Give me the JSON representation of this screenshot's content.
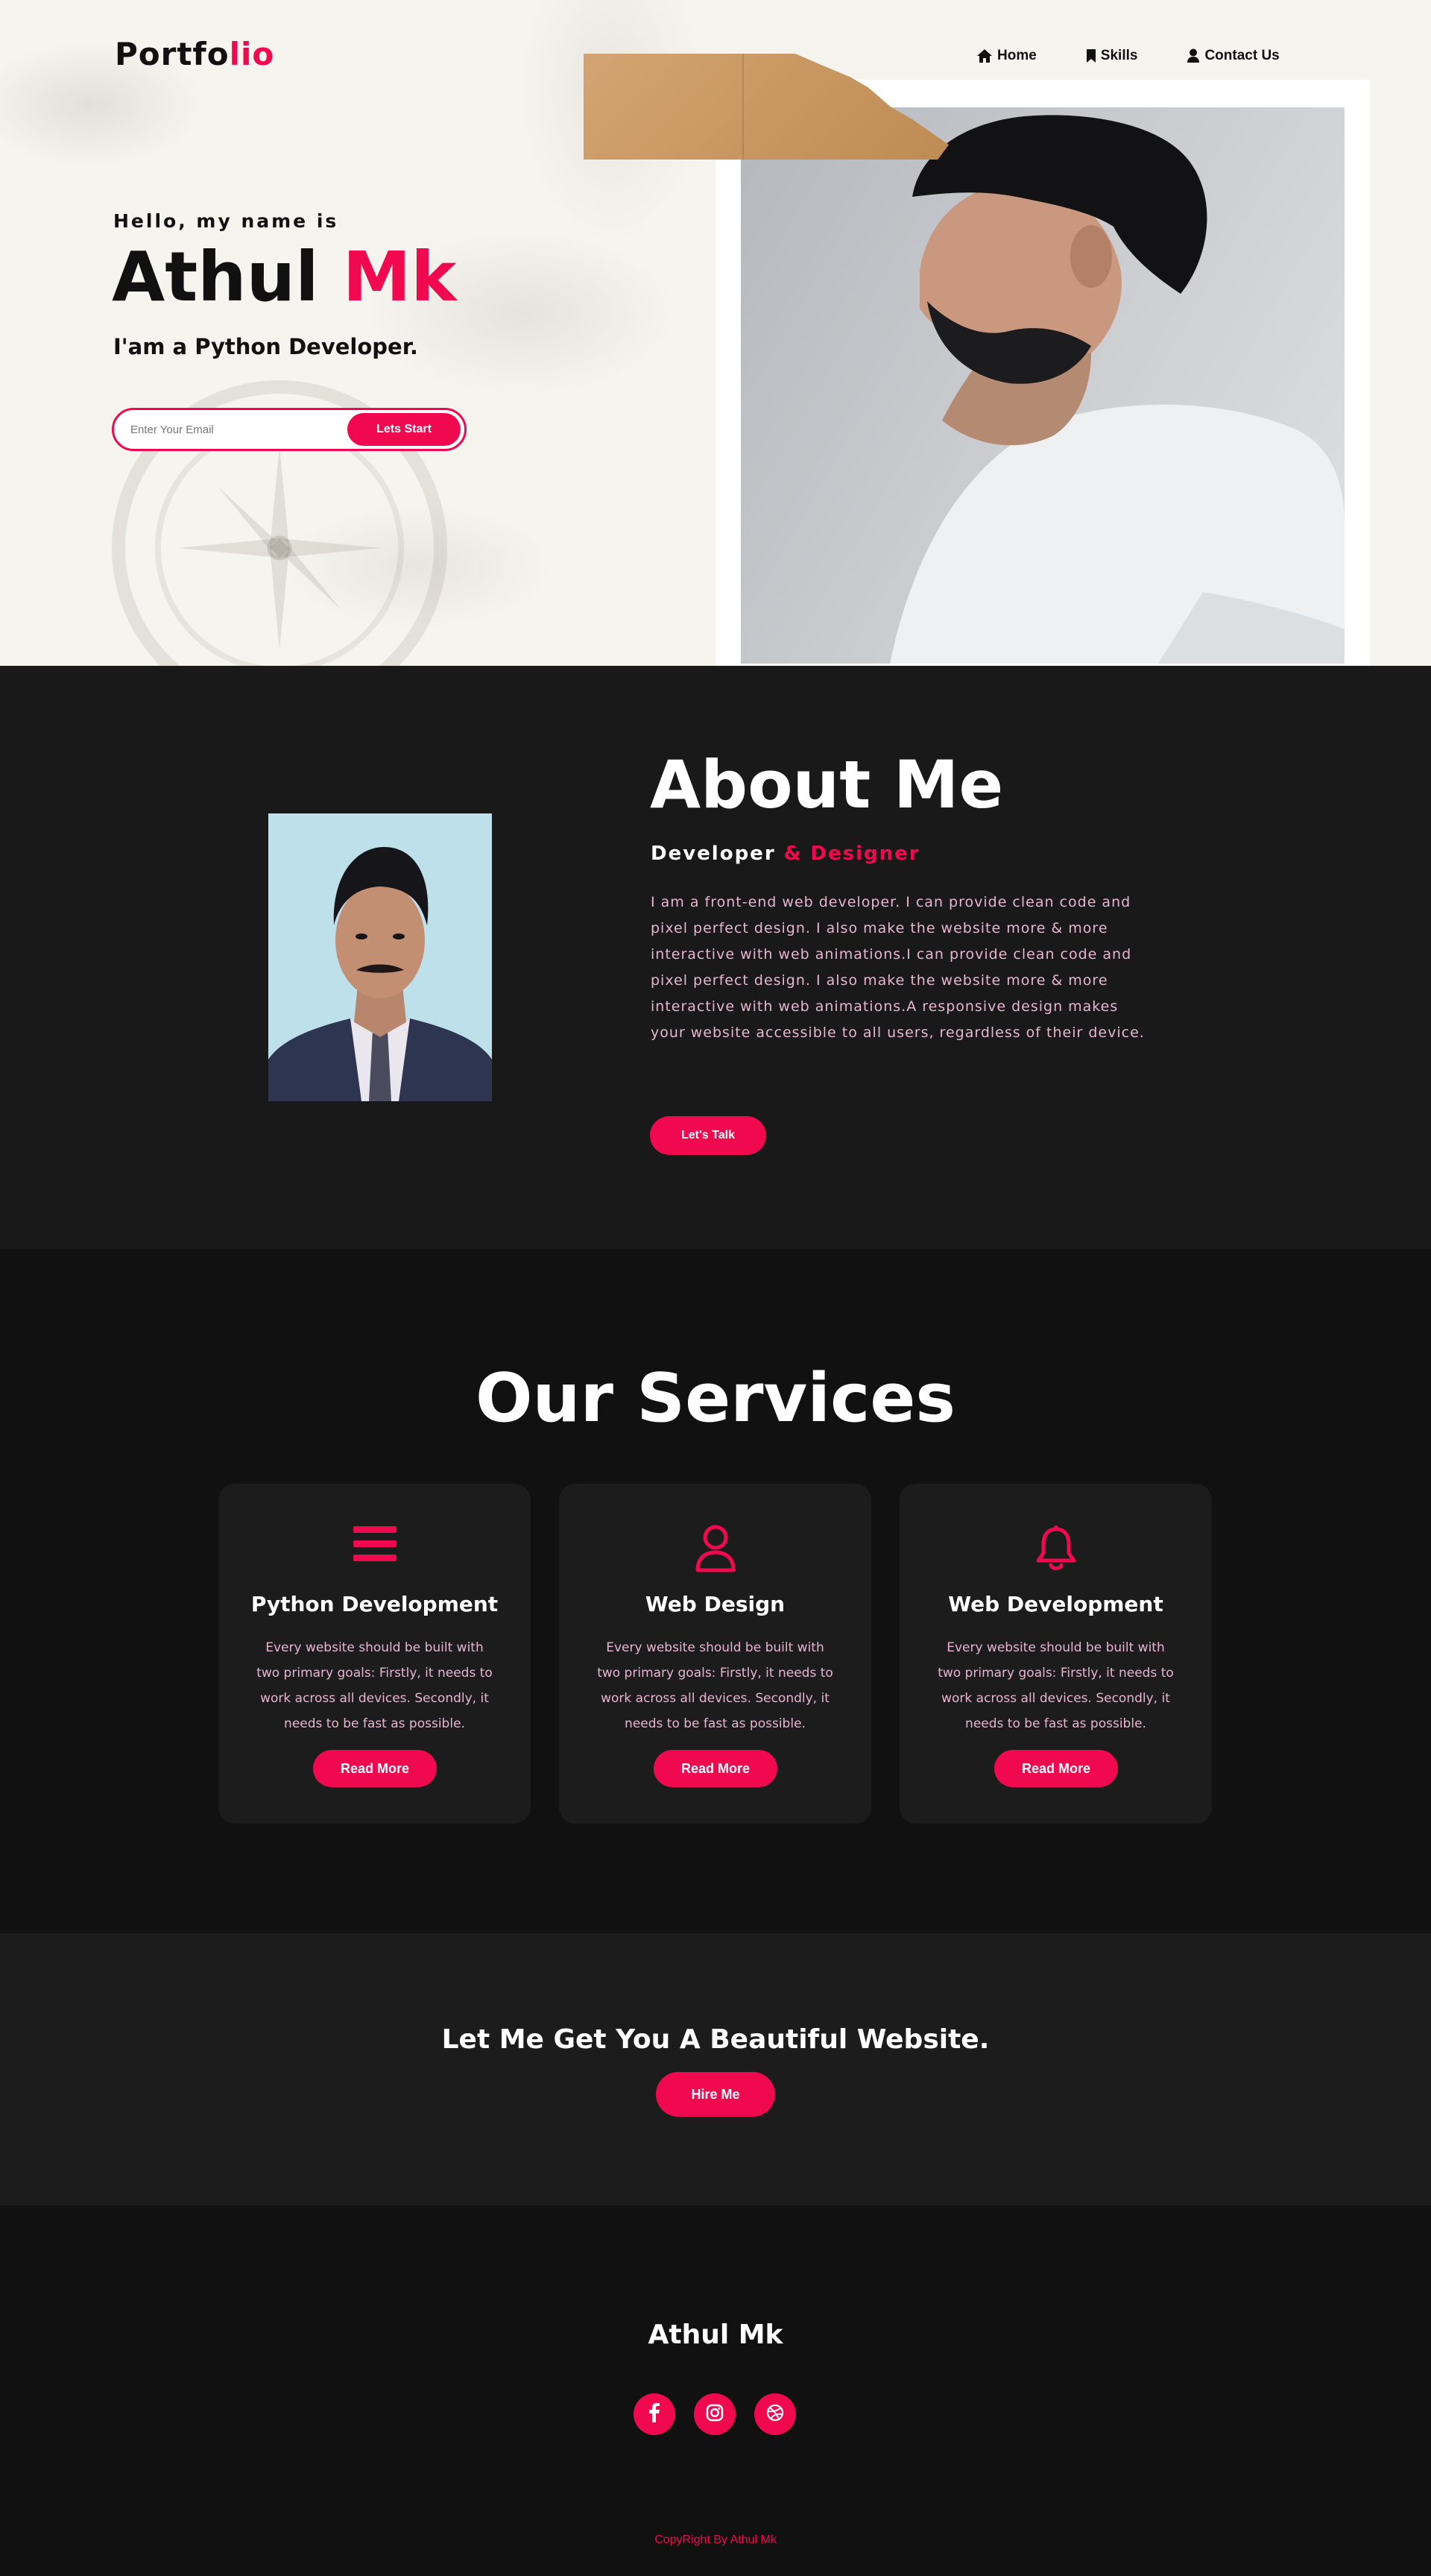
{
  "brand": {
    "logo_main": "Portfo",
    "logo_accent": "lio"
  },
  "nav": {
    "items": [
      {
        "label": "Home",
        "icon": "home-icon"
      },
      {
        "label": "Skills",
        "icon": "bookmark-icon"
      },
      {
        "label": "Contact Us",
        "icon": "user-icon"
      }
    ]
  },
  "hero": {
    "greeting": "Hello, my name is",
    "first_name": "Athul",
    "last_name": "Mk",
    "role": "I'am a Python Developer.",
    "email_placeholder": "Enter Your Email",
    "cta_label": "Lets Start"
  },
  "about": {
    "title": "About Me",
    "sub_main": "Developer",
    "sub_accent": "& Designer",
    "text": "I am a front-end web developer. I can provide clean code and pixel perfect design. I also make the website more & more interactive with web animations.I can provide clean code and pixel perfect design. I also make the website more & more interactive with web animations.A responsive design makes your website accessible to all users, regardless of their device.",
    "button_label": "Let's Talk"
  },
  "services": {
    "title": "Our Services",
    "cards": [
      {
        "icon": "menu-icon",
        "title": "Python Development",
        "text": "Every website should be built with two primary goals: Firstly, it needs to work across all devices. Secondly, it needs to be fast as possible.",
        "button": "Read More"
      },
      {
        "icon": "user-icon",
        "title": "Web Design",
        "text": "Every website should be built with two primary goals: Firstly, it needs to work across all devices. Secondly, it needs to be fast as possible.",
        "button": "Read More"
      },
      {
        "icon": "bell-icon",
        "title": "Web Development",
        "text": "Every website should be built with two primary goals: Firstly, it needs to work across all devices. Secondly, it needs to be fast as possible.",
        "button": "Read More"
      }
    ]
  },
  "hire": {
    "title": "Let Me Get You A Beautiful Website.",
    "button_label": "Hire Me"
  },
  "footer": {
    "name": "Athul Mk",
    "socials": [
      {
        "icon": "facebook-icon"
      },
      {
        "icon": "instagram-icon"
      },
      {
        "icon": "dribbble-icon"
      }
    ],
    "copyright": "CopyRight By Athul Mk"
  },
  "colors": {
    "accent": "#f0094f",
    "hero_bg": "#f6f4ef",
    "about_bg": "#191919",
    "dark_bg": "#111111",
    "card_bg": "#1c1c1c",
    "body_text": "#e7b6cf"
  }
}
